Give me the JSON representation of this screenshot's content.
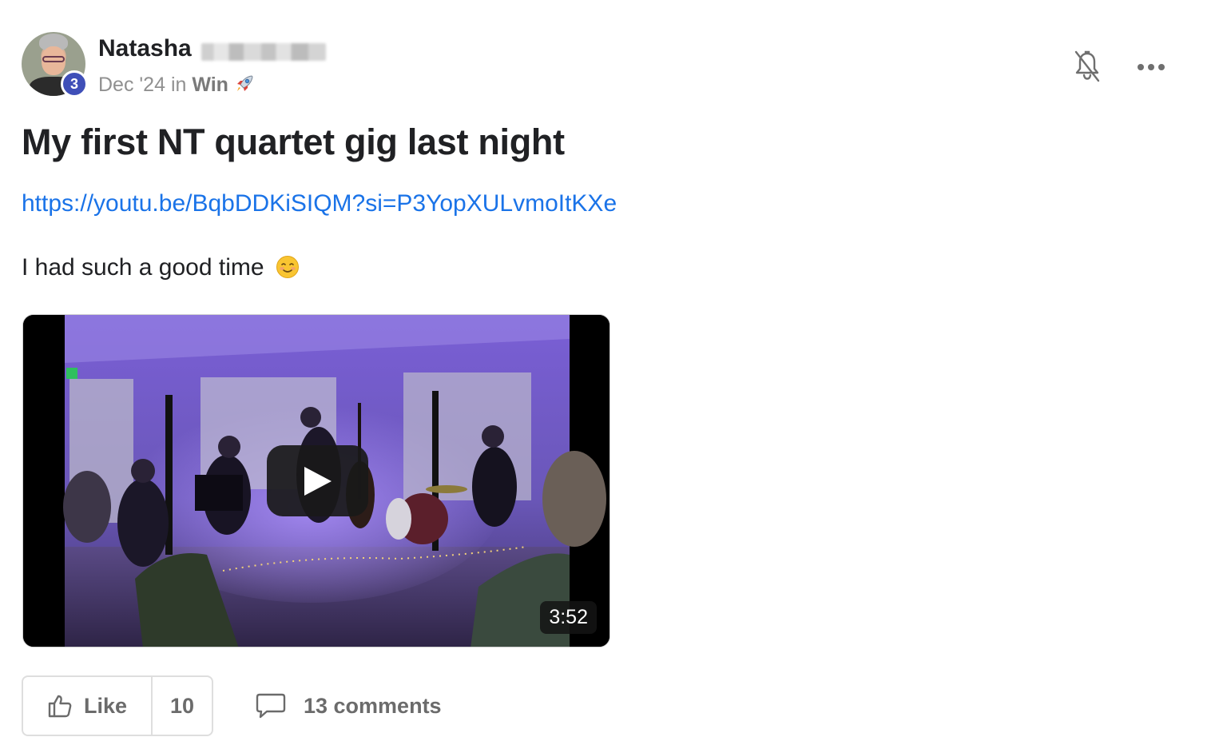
{
  "author": {
    "name": "Natasha",
    "level": "3"
  },
  "meta": {
    "date": "Dec '24",
    "in": "in",
    "category": "Win"
  },
  "post": {
    "title": "My first NT quartet gig last night",
    "link": "https://youtu.be/BqbDDKiSIQM?si=P3YopXULvmoItKXe",
    "body": "I had such a good time"
  },
  "video": {
    "duration": "3:52"
  },
  "actions": {
    "like_label": "Like",
    "like_count": "10",
    "comments_label": "13 comments"
  },
  "icons": {
    "bell": "bell-off-icon",
    "more": "more-horizontal-icon",
    "like": "thumbs-up-icon",
    "comment": "comment-bubble-icon",
    "category": "rocket-icon",
    "emoji": "smiling-face-icon"
  }
}
